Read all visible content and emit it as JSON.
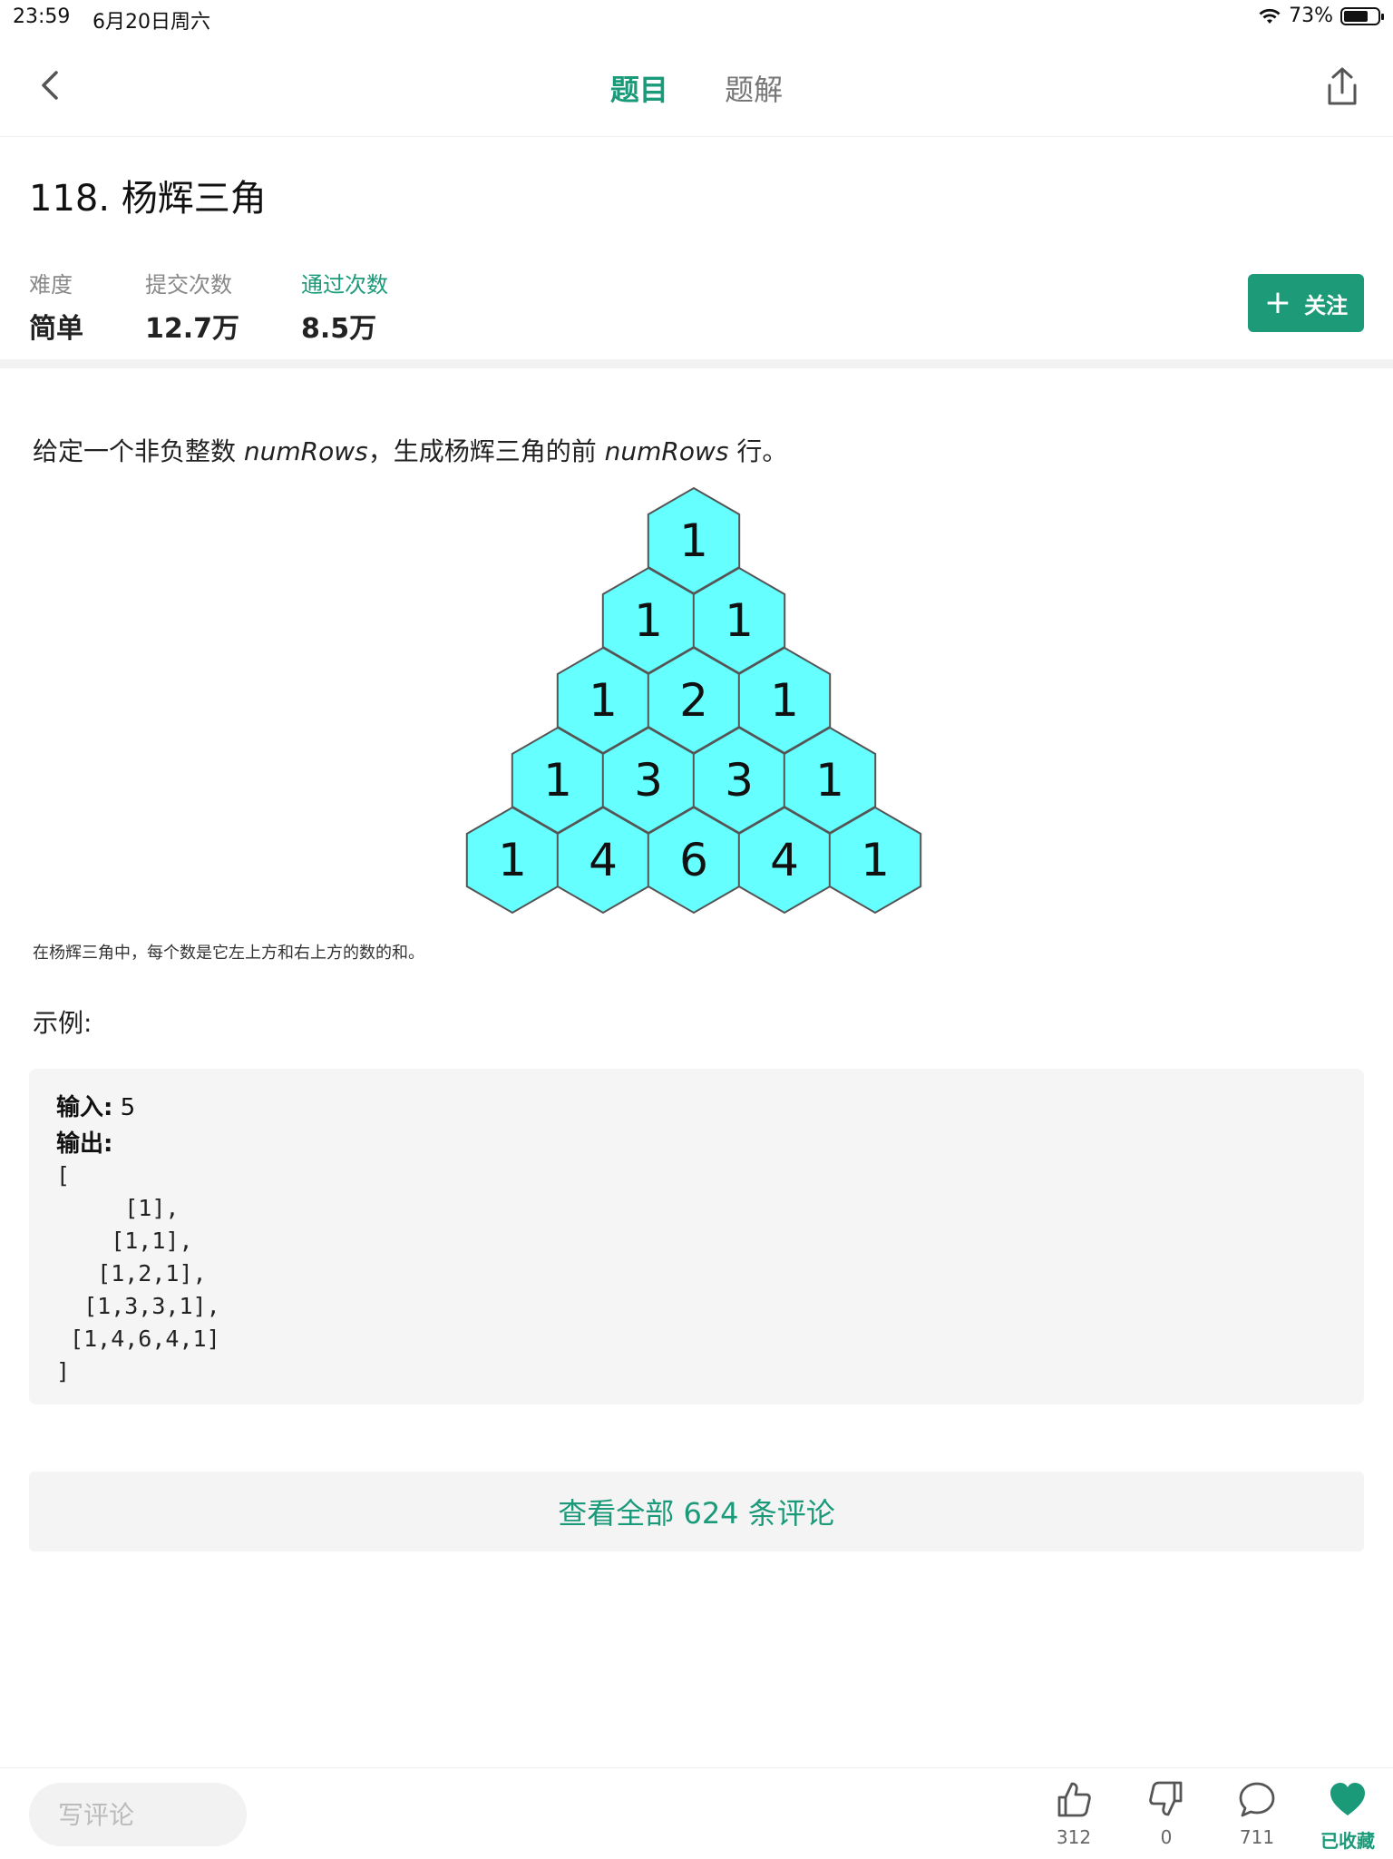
{
  "status_bar": {
    "time": "23:59",
    "date": "6月20日周六",
    "battery": "73%",
    "battery_level": 0.73
  },
  "nav": {
    "tabs": [
      {
        "label": "题目",
        "active": true
      },
      {
        "label": "题解",
        "active": false
      }
    ]
  },
  "problem": {
    "title": "118. 杨辉三角",
    "stats": {
      "difficulty_label": "难度",
      "difficulty_value": "简单",
      "submissions_label": "提交次数",
      "submissions_value": "12.7万",
      "accepted_label": "通过次数",
      "accepted_value": "8.5万"
    },
    "follow_label": "关注",
    "description": {
      "part1": "给定一个非负整数 ",
      "var1": "numRows",
      "part2": "，生成杨辉三角的前 ",
      "var2": "numRows",
      "part3": " 行。"
    },
    "triangle_rows": [
      [
        1
      ],
      [
        1,
        1
      ],
      [
        1,
        2,
        1
      ],
      [
        1,
        3,
        3,
        1
      ],
      [
        1,
        4,
        6,
        4,
        1
      ]
    ],
    "caption": "在杨辉三角中，每个数是它左上方和右上方的数的和。",
    "example_heading": "示例:",
    "example": {
      "input_label": "输入:",
      "input_value": "5",
      "output_label": "输出:",
      "output_lines": [
        "[",
        "     [1],",
        "    [1,1],",
        "   [1,2,1],",
        "  [1,3,3,1],",
        " [1,4,6,4,1]",
        "]"
      ]
    }
  },
  "comments_button": "查看全部 624 条评论",
  "bottom_bar": {
    "comment_placeholder": "写评论",
    "likes": "312",
    "dislikes": "0",
    "comments": "711",
    "favorited_label": "已收藏"
  },
  "colors": {
    "accent": "#1b9a79",
    "hex_fill": "#66ffff",
    "hex_stroke": "#555555"
  }
}
